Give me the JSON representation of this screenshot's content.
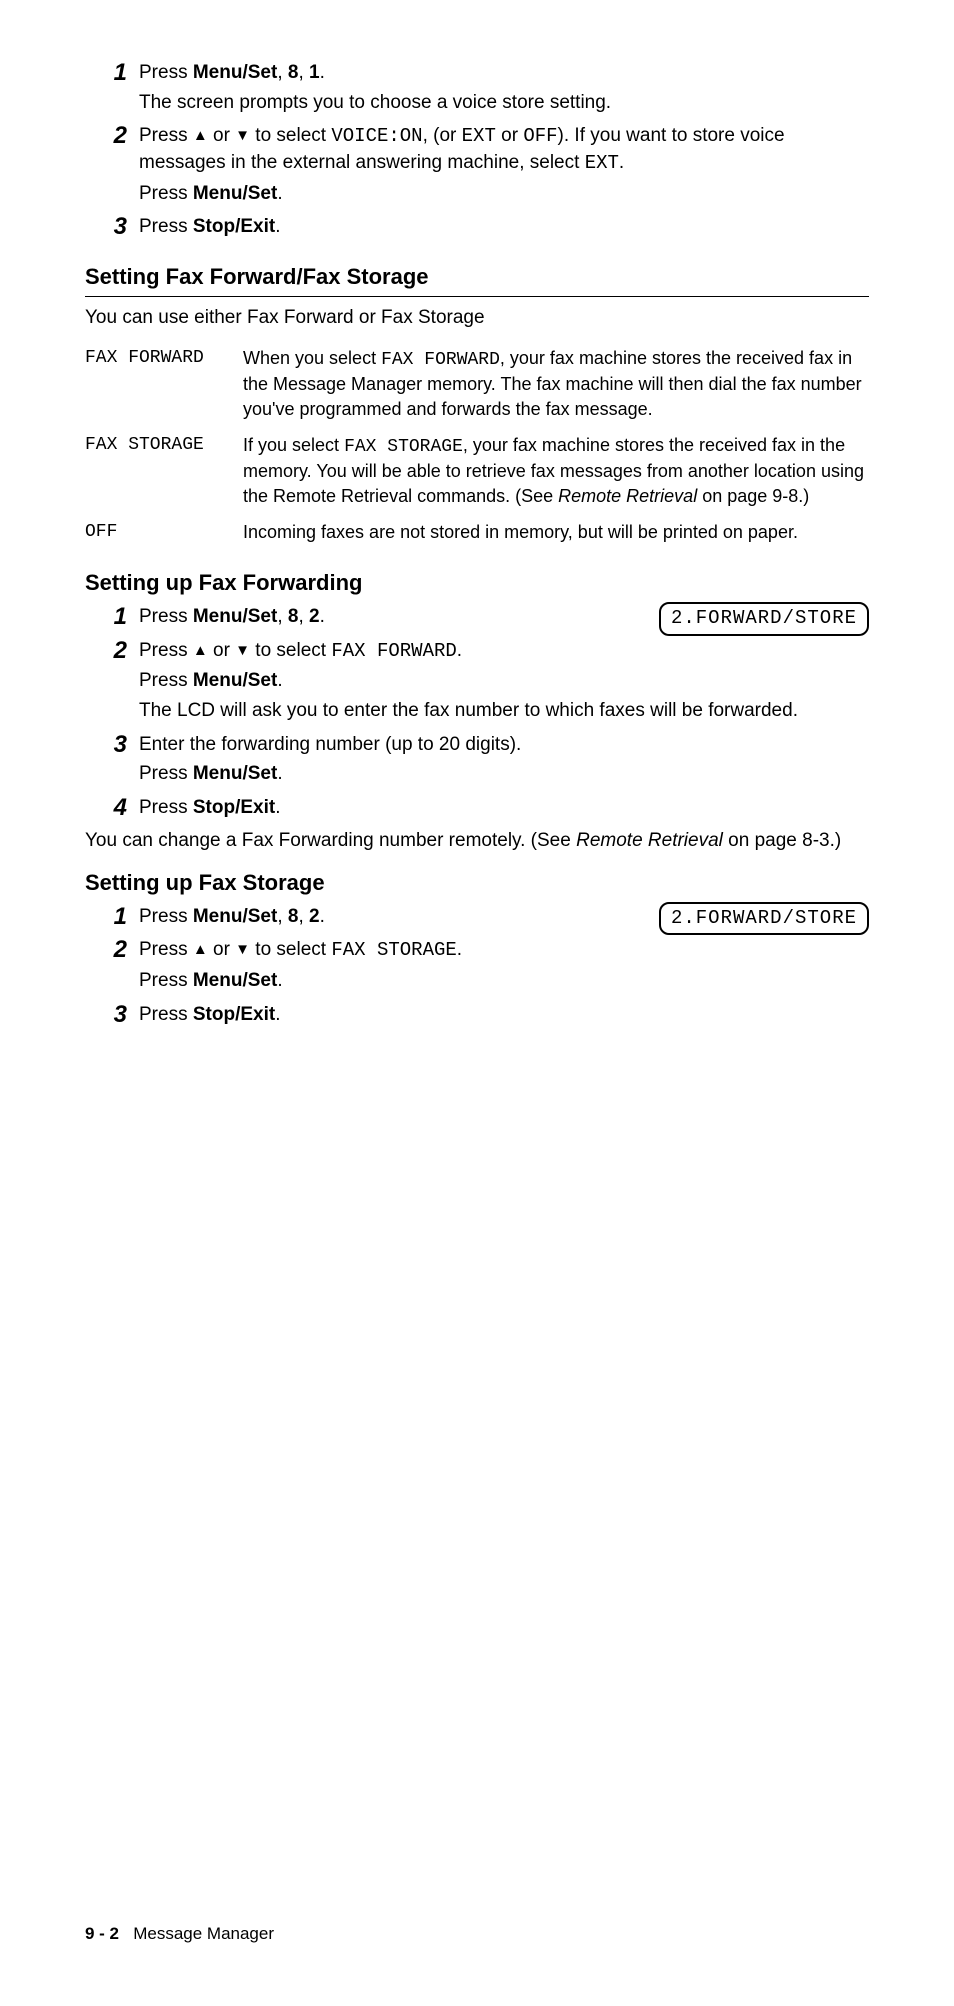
{
  "sectionA": {
    "steps": [
      {
        "num": "1",
        "parts": [
          {
            "t": "plain",
            "v": "Press "
          },
          {
            "t": "bold",
            "v": "Menu/Set"
          },
          {
            "t": "plain",
            "v": ", "
          },
          {
            "t": "bold",
            "v": "8"
          },
          {
            "t": "plain",
            "v": ", "
          },
          {
            "t": "bold",
            "v": "1"
          },
          {
            "t": "plain",
            "v": "."
          }
        ],
        "extraLines": [
          [
            {
              "t": "plain",
              "v": "The screen prompts you to choose a voice store setting."
            }
          ]
        ]
      },
      {
        "num": "2",
        "parts": [
          {
            "t": "plain",
            "v": "Press "
          },
          {
            "t": "up",
            "v": ""
          },
          {
            "t": "plain",
            "v": " or "
          },
          {
            "t": "down",
            "v": ""
          },
          {
            "t": "plain",
            "v": " to select "
          },
          {
            "t": "mono",
            "v": "VOICE:ON"
          },
          {
            "t": "plain",
            "v": ", (or "
          },
          {
            "t": "mono",
            "v": "EXT"
          },
          {
            "t": "plain",
            "v": " or "
          },
          {
            "t": "mono",
            "v": "OFF"
          },
          {
            "t": "plain",
            "v": "). If you want to store voice messages in the external answering machine, select "
          },
          {
            "t": "mono",
            "v": "EXT"
          },
          {
            "t": "plain",
            "v": "."
          }
        ],
        "extraLines": [
          [
            {
              "t": "plain",
              "v": "Press "
            },
            {
              "t": "bold",
              "v": "Menu/Set"
            },
            {
              "t": "plain",
              "v": "."
            }
          ]
        ]
      },
      {
        "num": "3",
        "parts": [
          {
            "t": "plain",
            "v": "Press "
          },
          {
            "t": "bold",
            "v": "Stop/Exit"
          },
          {
            "t": "plain",
            "v": "."
          }
        ],
        "extraLines": []
      }
    ]
  },
  "heading1": "Setting Fax Forward/Fax Storage",
  "intro1": "You can use either Fax Forward or Fax Storage",
  "table": [
    {
      "label": "FAX FORWARD",
      "desc": [
        {
          "t": "plain",
          "v": "When you select "
        },
        {
          "t": "mono",
          "v": "FAX FORWARD"
        },
        {
          "t": "plain",
          "v": ", your fax machine stores the received fax in the Message Manager memory. The fax machine will then dial the fax number you've programmed and forwards the fax message."
        }
      ]
    },
    {
      "label": "FAX STORAGE",
      "desc": [
        {
          "t": "plain",
          "v": "If you select "
        },
        {
          "t": "mono",
          "v": "FAX STORAGE"
        },
        {
          "t": "plain",
          "v": ", your fax machine stores the received fax in the memory. You will be able to retrieve fax messages from another location using the Remote Retrieval commands. (See "
        },
        {
          "t": "italic",
          "v": "Remote Retrieval"
        },
        {
          "t": "plain",
          "v": " on page 9-8.)"
        }
      ]
    },
    {
      "label": "OFF",
      "desc": [
        {
          "t": "plain",
          "v": "Incoming faxes are not stored in memory, but will be printed on paper."
        }
      ]
    }
  ],
  "heading2": "Setting up Fax Forwarding",
  "lcd1": "2.FORWARD/STORE",
  "sectionB": {
    "steps": [
      {
        "num": "1",
        "parts": [
          {
            "t": "plain",
            "v": "Press "
          },
          {
            "t": "bold",
            "v": "Menu/Set"
          },
          {
            "t": "plain",
            "v": ", "
          },
          {
            "t": "bold",
            "v": "8"
          },
          {
            "t": "plain",
            "v": ", "
          },
          {
            "t": "bold",
            "v": "2"
          },
          {
            "t": "plain",
            "v": "."
          }
        ],
        "extraLines": []
      },
      {
        "num": "2",
        "parts": [
          {
            "t": "plain",
            "v": "Press "
          },
          {
            "t": "up",
            "v": ""
          },
          {
            "t": "plain",
            "v": " or "
          },
          {
            "t": "down",
            "v": ""
          },
          {
            "t": "plain",
            "v": " to select "
          },
          {
            "t": "mono",
            "v": "FAX FORWARD"
          },
          {
            "t": "plain",
            "v": "."
          }
        ],
        "extraLines": [
          [
            {
              "t": "plain",
              "v": "Press "
            },
            {
              "t": "bold",
              "v": "Menu/Set"
            },
            {
              "t": "plain",
              "v": "."
            }
          ],
          [
            {
              "t": "plain",
              "v": "The LCD will ask you to enter the fax number to which faxes will be forwarded."
            }
          ]
        ]
      },
      {
        "num": "3",
        "parts": [
          {
            "t": "plain",
            "v": "Enter the forwarding number (up to 20 digits)."
          }
        ],
        "extraLines": [
          [
            {
              "t": "plain",
              "v": "Press "
            },
            {
              "t": "bold",
              "v": "Menu/Set"
            },
            {
              "t": "plain",
              "v": "."
            }
          ]
        ]
      },
      {
        "num": "4",
        "parts": [
          {
            "t": "plain",
            "v": "Press "
          },
          {
            "t": "bold",
            "v": "Stop/Exit"
          },
          {
            "t": "plain",
            "v": "."
          }
        ],
        "extraLines": []
      }
    ]
  },
  "note2": [
    {
      "t": "plain",
      "v": "You can change a Fax Forwarding number remotely. (See "
    },
    {
      "t": "italic",
      "v": "Remote Retrieval"
    },
    {
      "t": "plain",
      "v": " on page 8-3.)"
    }
  ],
  "heading3": "Setting up Fax Storage",
  "lcd2": "2.FORWARD/STORE",
  "sectionC": {
    "steps": [
      {
        "num": "1",
        "parts": [
          {
            "t": "plain",
            "v": "Press "
          },
          {
            "t": "bold",
            "v": "Menu/Set"
          },
          {
            "t": "plain",
            "v": ", "
          },
          {
            "t": "bold",
            "v": "8"
          },
          {
            "t": "plain",
            "v": ", "
          },
          {
            "t": "bold",
            "v": "2"
          },
          {
            "t": "plain",
            "v": "."
          }
        ],
        "extraLines": []
      },
      {
        "num": "2",
        "parts": [
          {
            "t": "plain",
            "v": "Press "
          },
          {
            "t": "up",
            "v": ""
          },
          {
            "t": "plain",
            "v": " or "
          },
          {
            "t": "down",
            "v": ""
          },
          {
            "t": "plain",
            "v": " to select "
          },
          {
            "t": "mono",
            "v": "FAX STORAGE"
          },
          {
            "t": "plain",
            "v": "."
          }
        ],
        "extraLines": [
          [
            {
              "t": "plain",
              "v": "Press "
            },
            {
              "t": "bold",
              "v": "Menu/Set"
            },
            {
              "t": "plain",
              "v": "."
            }
          ]
        ]
      },
      {
        "num": "3",
        "parts": [
          {
            "t": "plain",
            "v": "Press "
          },
          {
            "t": "bold",
            "v": "Stop/Exit"
          },
          {
            "t": "plain",
            "v": "."
          }
        ],
        "extraLines": []
      }
    ]
  },
  "footer": {
    "page": "9 - 2",
    "section": "Message Manager"
  }
}
